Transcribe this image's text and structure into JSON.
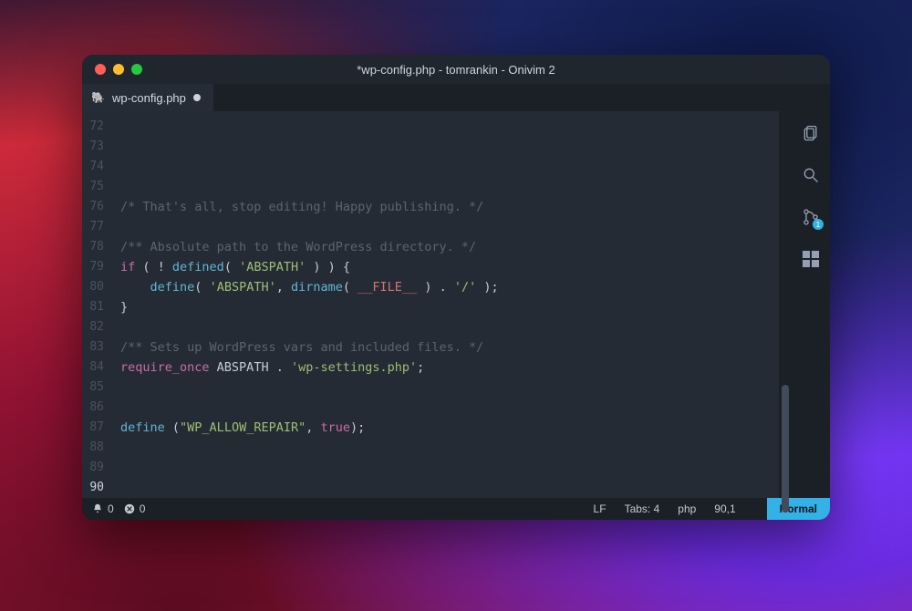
{
  "window": {
    "title": "*wp-config.php - tomrankin - Onivim 2"
  },
  "tab": {
    "icon": "php-icon",
    "label": "wp-config.php",
    "dirty": true
  },
  "gutter": {
    "start": 72,
    "end": 90,
    "current": 90
  },
  "code": {
    "l72": "",
    "l73": "",
    "l74": "",
    "l75_a": "/* That's all, stop editing! Happy publishing. */",
    "l76": "",
    "l77_a": "/** Absolute path to the WordPress directory. */",
    "l78_kw": "if",
    "l78_a": " ( ! ",
    "l78_fn": "defined",
    "l78_b": "( ",
    "l78_str": "'ABSPATH'",
    "l78_c": " ) ) {",
    "l79_pad": "    ",
    "l79_fn": "define",
    "l79_a": "( ",
    "l79_str": "'ABSPATH'",
    "l79_b": ", ",
    "l79_fn2": "dirname",
    "l79_c": "( ",
    "l79_mag": "__FILE__",
    "l79_d": " ) . ",
    "l79_str2": "'/'",
    "l79_e": " );",
    "l80": "}",
    "l81": "",
    "l82_a": "/** Sets up WordPress vars and included files. */",
    "l83_kw": "require_once",
    "l83_a": " ABSPATH . ",
    "l83_str": "'wp-settings.php'",
    "l83_b": ";",
    "l84": "",
    "l85": "",
    "l86_fn": "define",
    "l86_a": " (",
    "l86_str": "\"WP_ALLOW_REPAIR\"",
    "l86_b": ", ",
    "l86_kw": "true",
    "l86_c": ");",
    "l87": "",
    "l88": "",
    "l89": ""
  },
  "sidebar": {
    "git_badge": "1"
  },
  "status": {
    "notifications": "0",
    "errors": "0",
    "eol": "LF",
    "indent": "Tabs: 4",
    "lang": "php",
    "pos": "90,1",
    "mode": "Normal"
  }
}
